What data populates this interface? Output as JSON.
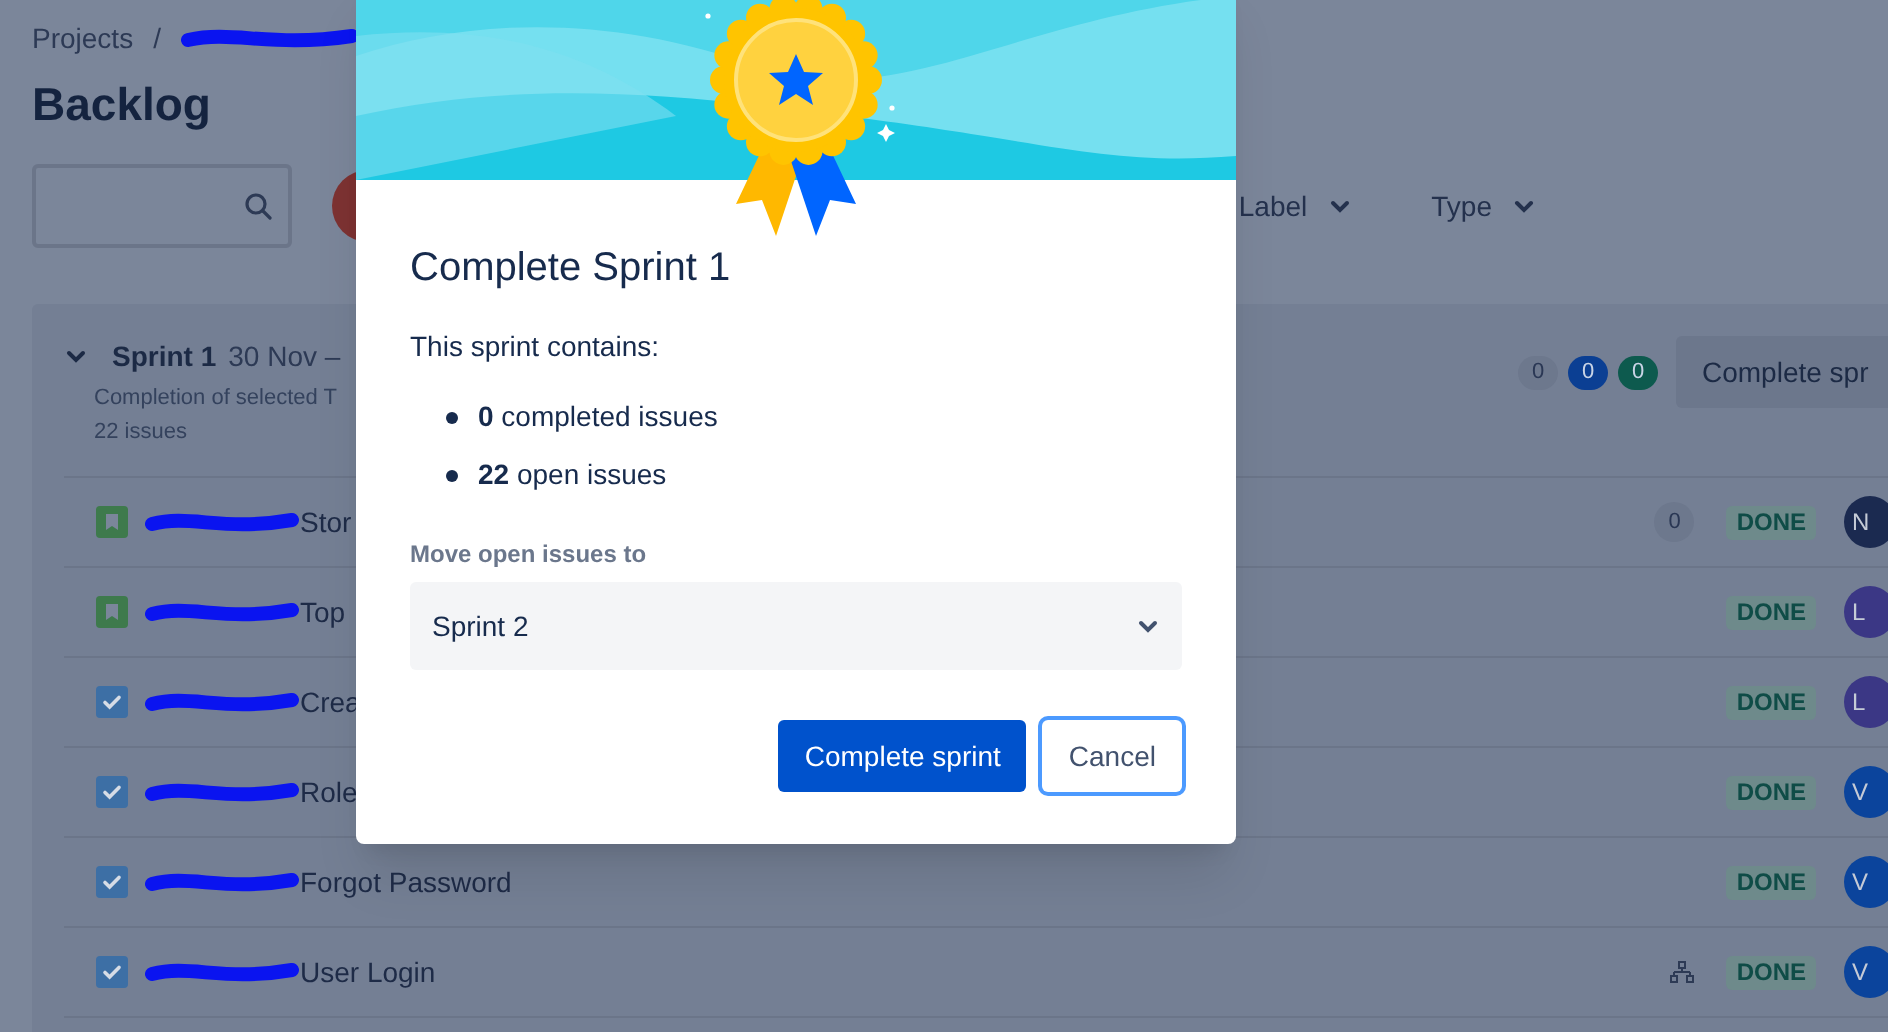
{
  "breadcrumb": {
    "items": [
      "Projects"
    ],
    "separator": "/",
    "redacted_tail": true
  },
  "page_title": "Backlog",
  "toolbar": {
    "filters": [
      "Label",
      "Type"
    ]
  },
  "sprint": {
    "expanded": true,
    "name": "Sprint 1",
    "dates": "30 Nov –",
    "goal": "Completion of selected T",
    "issue_count": "22 issues",
    "badges": [
      {
        "text": "0",
        "kind": "todo"
      },
      {
        "text": "0",
        "kind": "progress"
      },
      {
        "text": "0",
        "kind": "done"
      }
    ],
    "action": "Complete spr"
  },
  "issues": [
    {
      "kind": "story",
      "key_redacted": true,
      "summary": "Stor",
      "comments": "0",
      "child_issues": false,
      "status": "DONE",
      "assignee": "N",
      "color": "#1b2a50"
    },
    {
      "kind": "story",
      "key_redacted": true,
      "summary": "Top",
      "child_issues": false,
      "status": "DONE",
      "assignee": "L",
      "color": "#3b3785"
    },
    {
      "kind": "task",
      "key_redacted": true,
      "summary": "Crea",
      "child_issues": false,
      "status": "DONE",
      "assignee": "L",
      "color": "#3b3785"
    },
    {
      "kind": "task",
      "key_redacted": true,
      "summary": "Role",
      "child_issues": false,
      "status": "DONE",
      "assignee": "V",
      "color": "#0b449c"
    },
    {
      "kind": "task",
      "key_redacted": true,
      "summary": "Forgot Password",
      "child_issues": false,
      "status": "DONE",
      "assignee": "V",
      "color": "#0b449c"
    },
    {
      "kind": "task",
      "key_redacted": true,
      "summary": "User Login",
      "child_issues": true,
      "status": "DONE",
      "assignee": "V",
      "color": "#0b449c"
    }
  ],
  "dialog": {
    "title": "Complete Sprint 1",
    "intro": "This sprint contains:",
    "bullets": [
      "**0** completed issues",
      "**22** open issues"
    ],
    "select": {
      "label": "Move open issues to",
      "value": "Sprint 2"
    },
    "buttons": [
      {
        "label": "Complete sprint",
        "kind": "primary",
        "focused": false
      },
      {
        "label": "Cancel",
        "kind": "secondary",
        "focused": true
      }
    ]
  }
}
